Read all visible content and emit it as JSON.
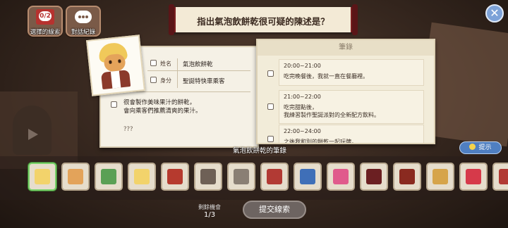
{
  "top_buttons": {
    "clues": {
      "label": "選擇的線索",
      "count": "0/2"
    },
    "chat": {
      "label": "對話紀錄"
    }
  },
  "question": "指出氣泡飲餅乾很可疑的陳述是？",
  "profile": {
    "name_label": "姓名",
    "name_value": "氣泡飲餅乾",
    "role_label": "身分",
    "role_value": "聖誕特快車乘客",
    "desc_line1": "很會製作美味果汁的餅乾，",
    "desc_line2": "會向乘客們推薦清爽的果汁。",
    "unknown": "???"
  },
  "notes": {
    "header": "筆錄",
    "entries": [
      {
        "time": "20:00~21:00",
        "text": "吃完晚餐後，我就一直在餐廳裡。"
      },
      {
        "time": "21:00~22:00",
        "text": "吃完甜點後，"
      },
      {
        "time": "",
        "text": "我練習製作聖誕派對的全新配方飲料。"
      },
      {
        "time": "22:00~24:00",
        "text": "之後我和別的餅乾一起玩牌，"
      }
    ]
  },
  "notes_caption": "氣泡飲餅乾的筆錄",
  "hint_label": "提示",
  "items": [
    {
      "icon": "note-with-cookie-icon",
      "color": "#f2d36b"
    },
    {
      "icon": "note-with-cookie-icon",
      "color": "#e3a35a"
    },
    {
      "icon": "note-with-cookie-icon",
      "color": "#5aa055"
    },
    {
      "icon": "note-with-cookie-icon",
      "color": "#f2d36b"
    },
    {
      "icon": "note-with-cookie-icon",
      "color": "#b63a2e"
    },
    {
      "icon": "photo-icon",
      "color": "#6e6056"
    },
    {
      "icon": "photo-icon",
      "color": "#8a7f74"
    },
    {
      "icon": "red-book-icon",
      "color": "#b23a34"
    },
    {
      "icon": "blue-book-icon",
      "color": "#3f6fb8"
    },
    {
      "icon": "candy-cane-icon",
      "color": "#e05a8c"
    },
    {
      "icon": "dark-book-icon",
      "color": "#6b1f22"
    },
    {
      "icon": "wand-icon",
      "color": "#8a2a20"
    },
    {
      "icon": "envelope-icon",
      "color": "#d6a44a"
    },
    {
      "icon": "cake-icon",
      "color": "#d63a4a"
    },
    {
      "icon": "book-edge-icon",
      "color": "#b23a34"
    }
  ],
  "remaining_label": "剩餘機會",
  "remaining_value": "1/3",
  "submit_label": "提交線索"
}
